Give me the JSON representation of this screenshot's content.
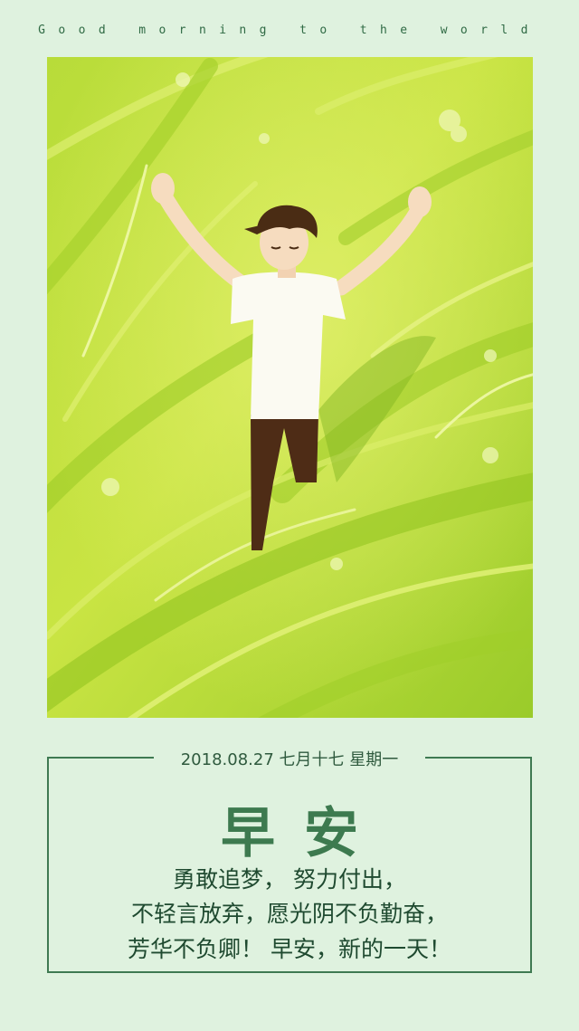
{
  "header": {
    "tagline": "Good morning to the world"
  },
  "card": {
    "date": "2018.08.27 七月十七 星期一",
    "title": "早安",
    "lines": [
      "勇敢追梦， 努力付出，",
      "不轻言放弃，愿光阴不负勤奋，",
      "芳华不负卿！ 早安，新的一天！"
    ]
  },
  "colors": {
    "background": "#dff2df",
    "frame": "#3f7a52",
    "grass_light": "#d4ea4a",
    "grass_dark": "#8fc21f",
    "shirt": "#fbfaf2",
    "pants": "#4e2c16"
  }
}
